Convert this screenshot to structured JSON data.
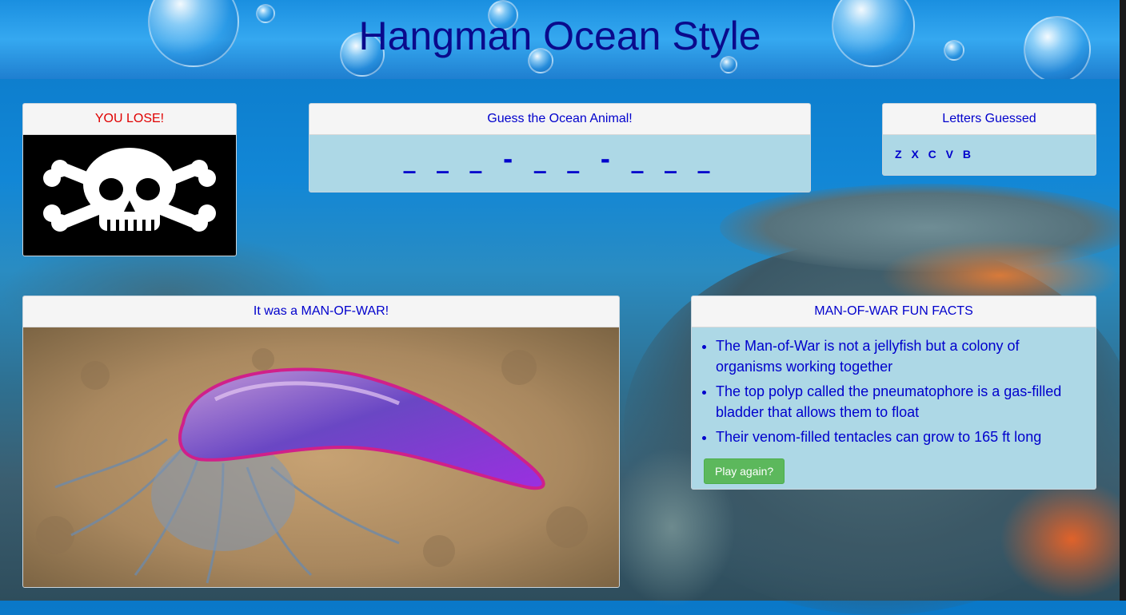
{
  "header": {
    "title": "Hangman Ocean Style"
  },
  "status_panel": {
    "heading": "YOU LOSE!",
    "image_icon": "skull-and-crossbones-icon"
  },
  "word_panel": {
    "heading": "Guess the Ocean Animal!",
    "masked_word": "_ _ _ - _ _ - _ _ _"
  },
  "guessed_panel": {
    "heading": "Letters Guessed",
    "letters": "Z X C V B"
  },
  "reveal_panel": {
    "heading": "It was a MAN-OF-WAR!"
  },
  "facts_panel": {
    "heading": "MAN-OF-WAR FUN FACTS",
    "facts": [
      "The Man-of-War is not a jellyfish but a colony of organisms working together",
      "The top polyp called the pneumatophore is a gas-filled bladder that allows them to float",
      "Their venom-filled tentacles can grow to 165 ft long"
    ],
    "play_again_label": "Play again?"
  },
  "colors": {
    "heading_text": "#0000cc",
    "lose_text": "#e00000",
    "panel_bg": "#add8e6",
    "button_bg": "#5cb85c"
  }
}
